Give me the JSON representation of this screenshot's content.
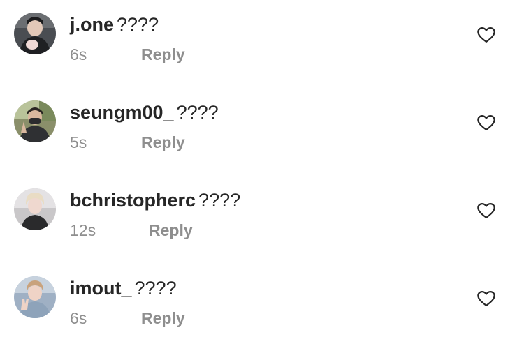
{
  "comments": [
    {
      "username": "j.one",
      "text": "????",
      "time": "6s",
      "reply_label": "Reply",
      "avatar_icon": "profile-photo-dark-hoodie",
      "like_icon": "heart-outline-icon"
    },
    {
      "username": "seungm00_",
      "text": "????",
      "time": "5s",
      "reply_label": "Reply",
      "avatar_icon": "profile-photo-mask-outdoors",
      "like_icon": "heart-outline-icon"
    },
    {
      "username": "bchristopherc",
      "text": "????",
      "time": "12s",
      "reply_label": "Reply",
      "avatar_icon": "profile-photo-blond-hair",
      "like_icon": "heart-outline-icon"
    },
    {
      "username": "imout_",
      "text": "????",
      "time": "6s",
      "reply_label": "Reply",
      "avatar_icon": "profile-photo-peace-sign",
      "like_icon": "heart-outline-icon"
    }
  ],
  "colors": {
    "text_primary": "#262626",
    "text_secondary": "#8e8e8e",
    "background": "#ffffff"
  }
}
